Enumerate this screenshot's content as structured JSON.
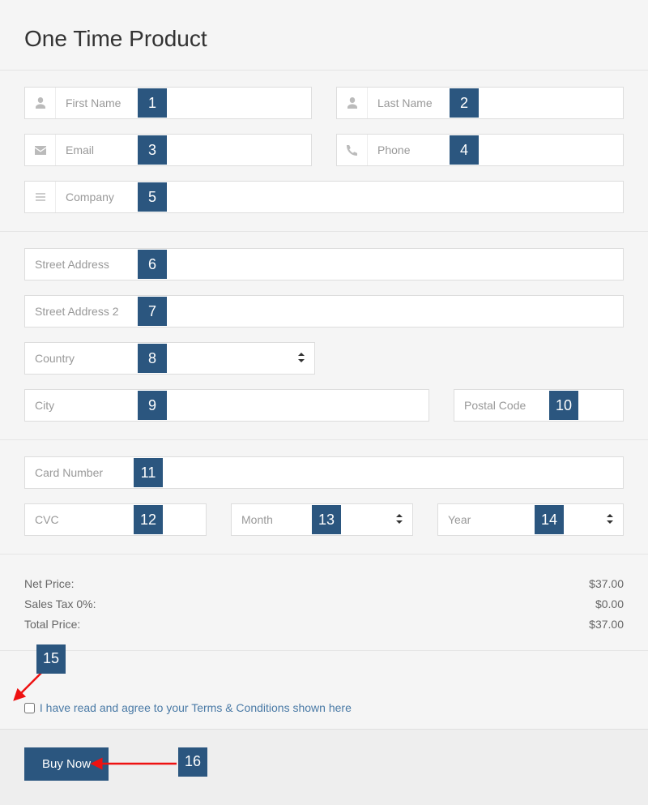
{
  "title": "One Time Product",
  "fields": {
    "first_name": {
      "placeholder": "First Name",
      "badge": "1"
    },
    "last_name": {
      "placeholder": "Last Name",
      "badge": "2"
    },
    "email": {
      "placeholder": "Email",
      "badge": "3"
    },
    "phone": {
      "placeholder": "Phone",
      "badge": "4"
    },
    "company": {
      "placeholder": "Company",
      "badge": "5"
    },
    "street1": {
      "placeholder": "Street Address",
      "badge": "6"
    },
    "street2": {
      "placeholder": "Street Address 2",
      "badge": "7"
    },
    "country": {
      "label": "Country",
      "badge": "8"
    },
    "city": {
      "placeholder": "City",
      "badge": "9"
    },
    "postal": {
      "placeholder": "Postal Code",
      "badge": "10"
    },
    "card": {
      "placeholder": "Card Number",
      "badge": "11"
    },
    "cvc": {
      "placeholder": "CVC",
      "badge": "12"
    },
    "month": {
      "label": "Month",
      "badge": "13"
    },
    "year": {
      "label": "Year",
      "badge": "14"
    }
  },
  "summary": {
    "net_label": "Net Price:",
    "net_value": "$37.00",
    "tax_label": "Sales Tax 0%:",
    "tax_value": "$0.00",
    "total_label": "Total Price:",
    "total_value": "$37.00"
  },
  "terms": {
    "badge": "15",
    "text": "I have read and agree to your Terms & Conditions shown here"
  },
  "submit": {
    "badge": "16",
    "label": "Buy Now"
  }
}
